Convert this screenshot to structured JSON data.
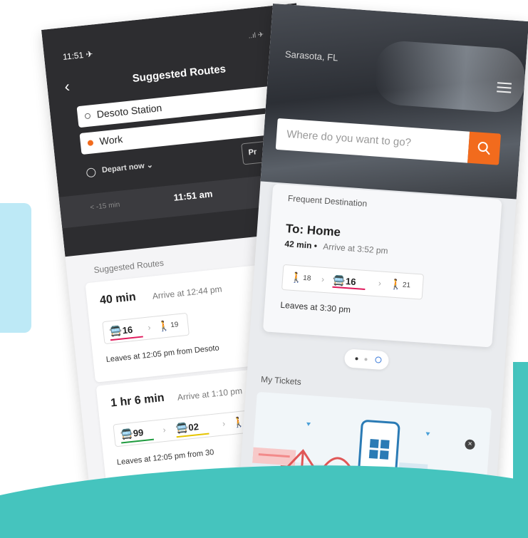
{
  "left_phone": {
    "status_time": "11:51 ✈",
    "signal": "..ıl ✈",
    "title": "Suggested Routes",
    "origin": "Desoto Station",
    "destination": "Work",
    "depart": "Depart now ⌄",
    "preferences": "Pr",
    "earlier": "< -15 min",
    "time": "11:51 am",
    "section_title": "Suggested Routes",
    "routes": [
      {
        "duration": "40 min",
        "arrive": "Arrive at 12:44 pm",
        "legs": [
          {
            "type": "bus",
            "label": "16",
            "color": "#e0195b"
          },
          {
            "type": "walk",
            "label": "19"
          }
        ],
        "leaves": "Leaves at 12:05 pm from Desoto"
      },
      {
        "duration": "1 hr 6 min",
        "arrive": "Arrive at 1:10 pm",
        "legs": [
          {
            "type": "bus",
            "label": "99",
            "color": "#1f9b3f"
          },
          {
            "type": "bus",
            "label": "02",
            "color": "#e5c400"
          },
          {
            "type": "walk",
            "label": ""
          }
        ],
        "leaves": "Leaves at 12:05 pm from 30"
      }
    ]
  },
  "right_phone": {
    "location": "Sarasota, FL",
    "search_placeholder": "Where do you want to go?",
    "frequent_label": "Frequent Destination",
    "to": "To: Home",
    "mins": "42 min •",
    "arrive": "Arrive at 3:52 pm",
    "legs": [
      {
        "type": "walk",
        "label": "18"
      },
      {
        "type": "bus",
        "label": "16",
        "color": "#e0195b"
      },
      {
        "type": "walk",
        "label": "21"
      }
    ],
    "leaves": "Leaves at 3:30 pm",
    "my_tickets": "My Tickets",
    "accent": "#f26b1d"
  },
  "colors": {
    "teal": "#45c4be",
    "light_blue": "#bde9f6"
  }
}
